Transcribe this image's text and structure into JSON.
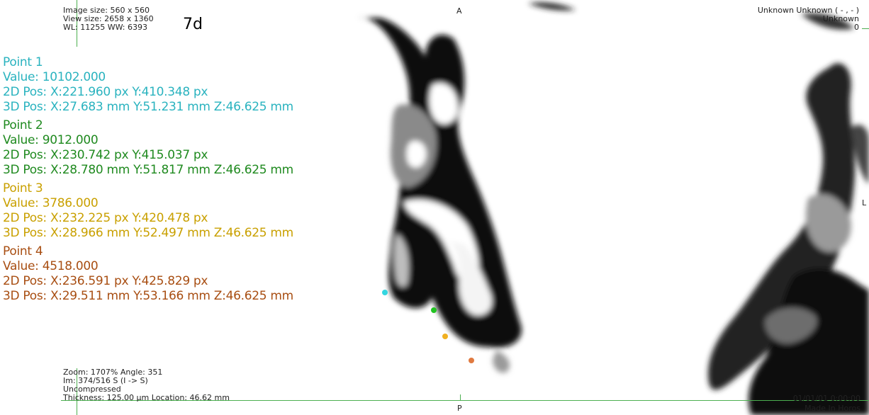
{
  "tag": "7d",
  "info_top_left": {
    "image_size": "Image size: 560 x 560",
    "view_size": "View size: 2658 x 1360",
    "window": "WL: 11255 WW: 6393"
  },
  "orientation": {
    "top": "A",
    "bottom": "P",
    "right": "L"
  },
  "info_top_right": {
    "patient": "Unknown Unknown ( - , - )",
    "line2": "Unknown",
    "line3": "0"
  },
  "points": [
    {
      "title": "Point 1",
      "value": "Value: 10102.000",
      "pos2d": "2D Pos: X:221.960 px Y:410.348 px",
      "pos3d": "3D Pos: X:27.683 mm Y:51.231 mm Z:46.625 mm",
      "color": "#2ab3bf"
    },
    {
      "title": "Point 2",
      "value": "Value: 9012.000",
      "pos2d": "2D Pos: X:230.742 px Y:415.037 px",
      "pos3d": "3D Pos: X:28.780 mm Y:51.817 mm Z:46.625 mm",
      "color": "#1f8a1f"
    },
    {
      "title": "Point 3",
      "value": "Value: 3786.000",
      "pos2d": "2D Pos: X:232.225 px Y:420.478 px",
      "pos3d": "3D Pos: X:28.966 mm Y:52.497 mm Z:46.625 mm",
      "color": "#c9a000"
    },
    {
      "title": "Point 4",
      "value": "Value: 4518.000",
      "pos2d": "2D Pos: X:236.591 px Y:425.829 px",
      "pos3d": "3D Pos: X:29.511 mm Y:53.166 mm Z:46.625 mm",
      "color": "#a84e12"
    }
  ],
  "point_marker_colors": [
    "#33d6e0",
    "#22c322",
    "#f0b020",
    "#e07a40"
  ],
  "info_bottom_left": {
    "zoom": "Zoom: 1707% Angle: 351",
    "image": "Im: 374/516  S (I -> S)",
    "compression": "Uncompressed",
    "thickness": "Thickness: 125.00 µm Location: 46.62 mm"
  },
  "info_bottom_right": {
    "datetime": "01/01/01 0:00:00",
    "credit": "Made In Horos"
  }
}
